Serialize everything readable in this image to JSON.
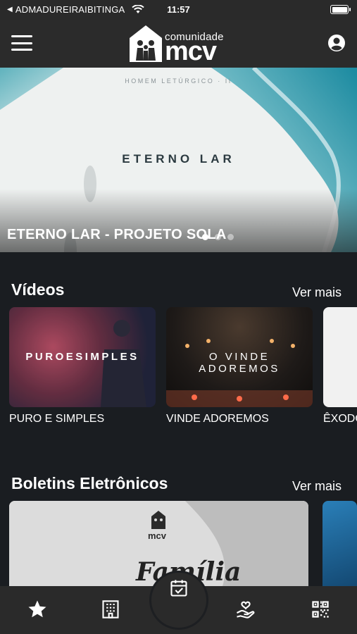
{
  "status_bar": {
    "carrier": "ADMADUREIRAIBITINGA",
    "time": "11:57"
  },
  "header": {
    "logo_small": "comunidade",
    "logo_big": "mcv",
    "menu_icon": "hamburger-menu-icon",
    "profile_icon": "user-circle-icon"
  },
  "hero": {
    "small_caption": "HOMEM LETÚRGICO · II",
    "center_title": "ETERNO LAR",
    "banner_title": "ETERNO LAR - PROJETO SOLA",
    "dots_count": 3,
    "active_dot": 0
  },
  "videos": {
    "title": "Vídeos",
    "see_more": "Ver mais",
    "items": [
      {
        "thumb_text": "PUROESIMPLES",
        "caption": "PURO E SIMPLES"
      },
      {
        "thumb_text": "O VINDE ADOREMOS",
        "caption": "VINDE ADOREMOS"
      },
      {
        "thumb_text": "",
        "caption": "ÊXODO"
      }
    ]
  },
  "bulletins": {
    "title": "Boletins Eletrônicos",
    "see_more": "Ver mais",
    "card_logo": "mcv",
    "card_script": "Família"
  },
  "bottom_nav": {
    "items": [
      "star-icon",
      "building-icon",
      "calendar-check-icon",
      "heart-hand-icon",
      "qr-code-icon"
    ],
    "active": "calendar-check-icon"
  },
  "colors": {
    "background": "#1a1d21",
    "header": "#2b2b2b",
    "nav": "#2a2a2a",
    "text": "#ffffff"
  }
}
